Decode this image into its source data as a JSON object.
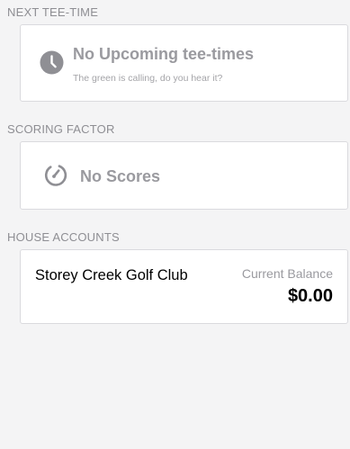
{
  "tee_time": {
    "section_label": "NEXT TEE-TIME",
    "title": "No Upcoming tee-times",
    "subtitle": "The green is calling, do you hear it?",
    "icon": "clock-icon"
  },
  "scoring": {
    "section_label": "SCORING FACTOR",
    "title": "No Scores",
    "icon": "gauge-icon"
  },
  "house_accounts": {
    "section_label": "HOUSE ACCOUNTS",
    "accounts": [
      {
        "club_name": "Storey Creek Golf Club",
        "balance_label": "Current Balance",
        "balance": "$0.00"
      }
    ]
  },
  "colors": {
    "background": "#f4f4f5",
    "card": "#ffffff",
    "muted_text": "#9a9a9f",
    "label_text": "#8e8e93",
    "primary_text": "#000000"
  }
}
